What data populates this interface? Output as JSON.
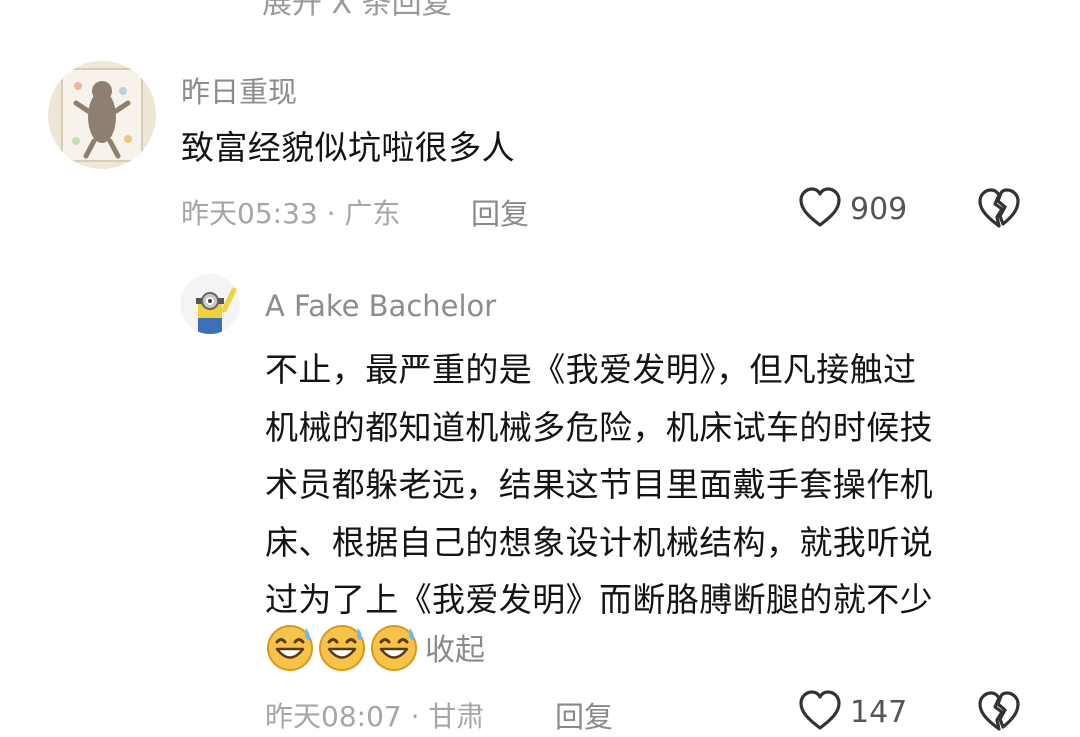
{
  "top_partial": "展开 X 条回复",
  "comment1": {
    "username": "昨日重现",
    "text": "致富经貌似坑啦很多人",
    "meta": "昨天05:33 · 广东",
    "reply_label": "回复",
    "likes": "909"
  },
  "comment2": {
    "username": "A Fake Bachelor",
    "lines": [
      "不止，最严重的是《我爱发明》，但凡接触过",
      "机械的都知道机械多危险，机床试车的时候技",
      "术员都躲老远，结果这节目里面戴手套操作机",
      "床、根据自己的想象设计机械结构，就我听说",
      "过为了上《我爱发明》而断胳膊断腿的就不少"
    ],
    "collapse_label": "收起",
    "meta": "昨天08:07 · 甘肃",
    "reply_label": "回复",
    "likes": "147"
  }
}
